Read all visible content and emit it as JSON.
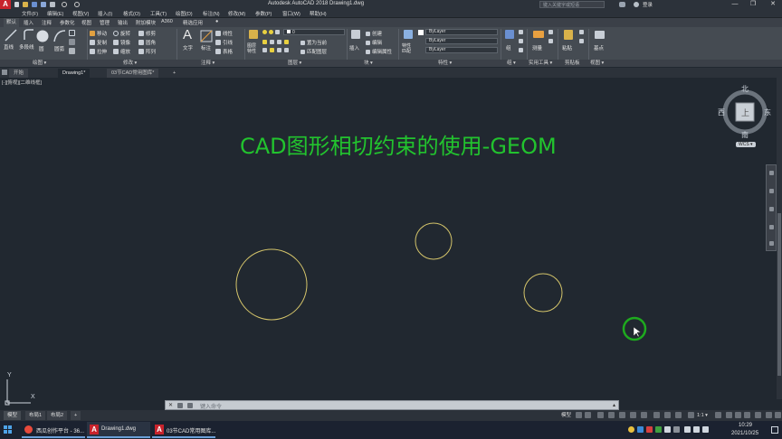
{
  "window": {
    "title": "Autodesk AutoCAD 2018    Drawing1.dwg",
    "search_placeholder": "键入关键字或短语",
    "user": "登录",
    "minimize": "—",
    "restore": "❐",
    "close": "✕"
  },
  "menubar": [
    "文件(F)",
    "编辑(E)",
    "视图(V)",
    "插入(I)",
    "格式(O)",
    "工具(T)",
    "绘图(D)",
    "标注(N)",
    "修改(M)",
    "参数(P)",
    "窗口(W)",
    "帮助(H)"
  ],
  "ribbon_tabs": [
    "默认",
    "插入",
    "注释",
    "参数化",
    "视图",
    "管理",
    "输出",
    "附加模块",
    "A360",
    "精选应用",
    "●"
  ],
  "ribbon": {
    "draw_buttons": [
      "直线",
      "多段线",
      "圆",
      "圆弧"
    ],
    "modify_rows": [
      [
        "移动",
        "旋转",
        "修剪"
      ],
      [
        "复制",
        "镜像",
        "圆角"
      ],
      [
        "拉伸",
        "缩放",
        "阵列"
      ]
    ],
    "text_label": "文字",
    "dim_label": "标注",
    "annot_rows": [
      "线性",
      "引线",
      "表格"
    ],
    "layer_props": "图层\n特性",
    "layer_value": "0",
    "layer_actions": [
      "置为当前",
      "匹配图层"
    ],
    "insert_label": "插入",
    "block_actions": [
      "创建",
      "编辑",
      "编辑属性"
    ],
    "props_label": "特性\n匹配",
    "bylayer": [
      "ByLayer",
      "ByLayer",
      "ByLayer"
    ],
    "group_label": "组",
    "measure_label": "测量",
    "paste_label": "粘贴",
    "base_label": "基点"
  },
  "panel_labels": [
    "绘图 ▾",
    "修改 ▾",
    "注释 ▾",
    "图层 ▾",
    "块 ▾",
    "特性 ▾",
    "组 ▾",
    "实用工具 ▾",
    "剪贴板",
    "视图 ▾"
  ],
  "doc_tabs": [
    "开始",
    "Drawing1*",
    "03节CAD常用图库*",
    "+"
  ],
  "viewport_label": "[-][俯视][二维线框]",
  "drawing": {
    "title": "CAD图形相切约束的使用-GEOM",
    "title_color": "#22c32e",
    "circle_color": "#d4c46a"
  },
  "viewcube": {
    "north": "北",
    "south": "南",
    "east": "东",
    "west": "西",
    "top": "上",
    "wcs": "WCS ▾"
  },
  "ucs": {
    "x": "X",
    "y": "Y"
  },
  "command_placeholder": "键入命令",
  "layout_tabs": [
    "模型",
    "布局1",
    "布局2",
    "+"
  ],
  "status": {
    "model": "模型",
    "scale": "1:1 ▾"
  },
  "taskbar": {
    "items": [
      "西瓜创作平台 - 36...",
      "Drawing1.dwg",
      "03节CAD常用图库..."
    ],
    "time": "10:29",
    "date": "2021/10/25"
  }
}
